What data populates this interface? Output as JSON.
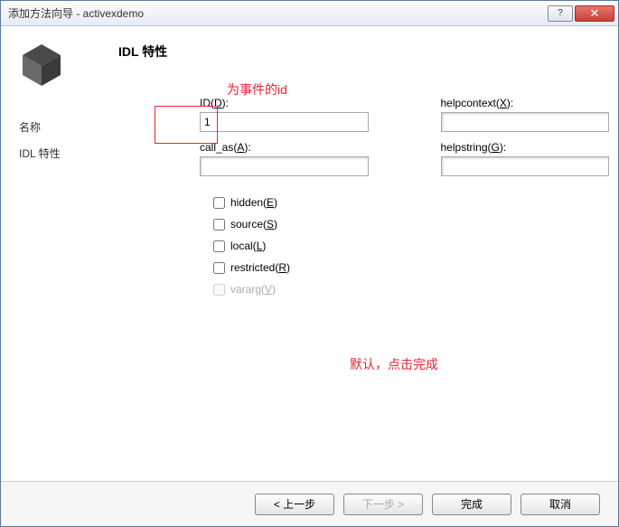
{
  "title": "添加方法向导 - activexdemo",
  "heading": "IDL 特性",
  "sidebar": {
    "items": [
      {
        "label": "名称"
      },
      {
        "label": "IDL 特性"
      }
    ]
  },
  "annotations": {
    "id_note": "为事件的id",
    "finish_note": "默认，点击完成"
  },
  "fields": {
    "id": {
      "label_pre": "ID(",
      "key": "D",
      "label_post": "):",
      "value": "1"
    },
    "helpcontext": {
      "label_pre": "helpcontext(",
      "key": "X",
      "label_post": "):",
      "value": ""
    },
    "call_as": {
      "label_pre": "call_as(",
      "key": "A",
      "label_post": "):",
      "value": ""
    },
    "helpstring": {
      "label_pre": "helpstring(",
      "key": "G",
      "label_post": "):",
      "value": ""
    }
  },
  "checks": {
    "hidden": {
      "pre": "hidden(",
      "key": "E",
      "post": ")"
    },
    "source": {
      "pre": "source(",
      "key": "S",
      "post": ")"
    },
    "local": {
      "pre": "local(",
      "key": "L",
      "post": ")"
    },
    "restricted": {
      "pre": "restricted(",
      "key": "R",
      "post": ")"
    },
    "vararg": {
      "pre": "vararg(",
      "key": "V",
      "post": ")"
    }
  },
  "buttons": {
    "prev": "< 上一步",
    "next": "下一步 >",
    "finish": "完成",
    "cancel": "取消"
  }
}
